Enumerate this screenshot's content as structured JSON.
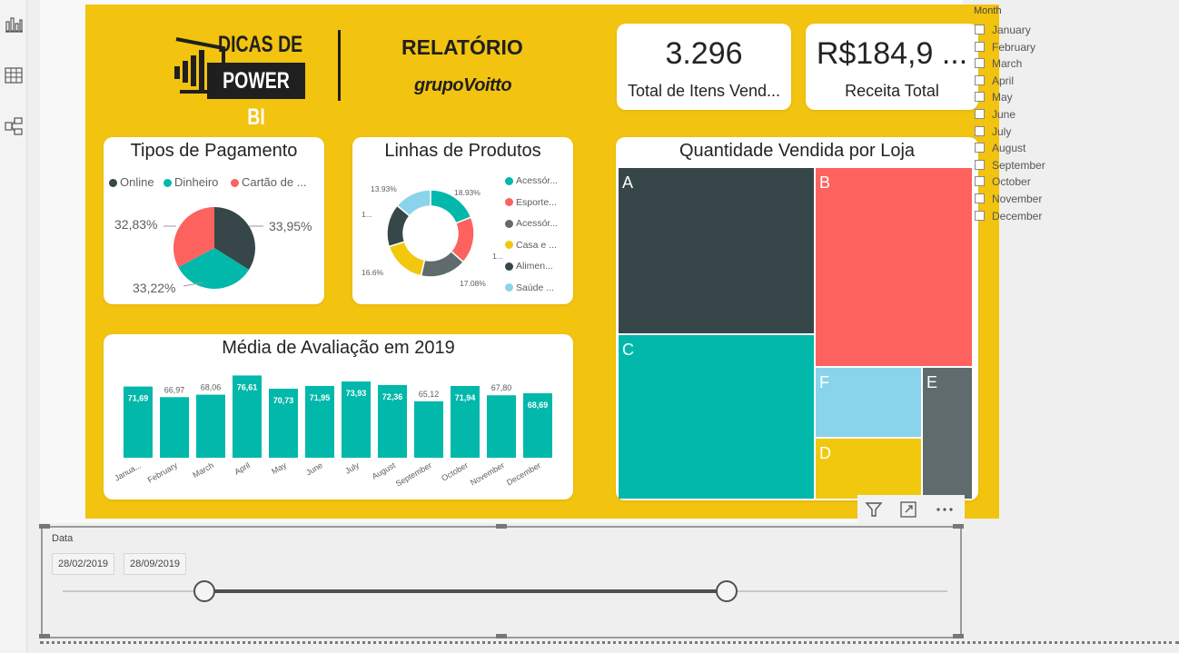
{
  "rail": {
    "icons": [
      "report-view-icon",
      "data-view-icon",
      "model-view-icon"
    ]
  },
  "header": {
    "logo_line1": "DICAS DE",
    "logo_line2": "POWER BI",
    "report_title": "RELATÓRIO",
    "brand": "grupoVoitto"
  },
  "kpis": [
    {
      "value": "3.296",
      "label": "Total de Itens Vend..."
    },
    {
      "value": "R$184,9 ...",
      "label": "Receita Total"
    }
  ],
  "colors": {
    "background": "#f2c30f",
    "dark": "#374649",
    "teal": "#01b8aa",
    "red": "#fd625e",
    "gray": "#5f6b6d",
    "yellow": "#f2c80f",
    "light_blue": "#8ad4eb"
  },
  "payments": {
    "title": "Tipos de Pagamento",
    "legend": [
      "Online",
      "Dinheiro",
      "Cartão de ..."
    ],
    "labels": [
      "33,95%",
      "33,22%",
      "32,83%"
    ]
  },
  "products": {
    "title": "Linhas de Produtos",
    "legend": [
      "Acessór...",
      "Esporte...",
      "Acessór...",
      "Casa e ...",
      "Alimen...",
      "Saúde ..."
    ],
    "labels": [
      "18.93%",
      "1...",
      "17.08%",
      "16.6%",
      "1...",
      "13.93%"
    ]
  },
  "ratings": {
    "title": "Média de Avaliação em 2019"
  },
  "treemap": {
    "title": "Quantidade Vendida por Loja",
    "labels": [
      "A",
      "B",
      "C",
      "F",
      "E",
      "D"
    ]
  },
  "chart_data": [
    {
      "type": "pie",
      "title": "Tipos de Pagamento",
      "categories": [
        "Online",
        "Dinheiro",
        "Cartão de ..."
      ],
      "values": [
        33.95,
        33.22,
        32.83
      ]
    },
    {
      "type": "pie",
      "title": "Linhas de Produtos",
      "categories": [
        "Acessór...",
        "Esporte...",
        "Acessór...",
        "Casa e ...",
        "Alimen...",
        "Saúde ..."
      ],
      "values": [
        18.93,
        17.5,
        17.08,
        16.6,
        15.96,
        13.93
      ]
    },
    {
      "type": "bar",
      "title": "Média de Avaliação em 2019",
      "categories": [
        "Janua...",
        "February",
        "March",
        "April",
        "May",
        "June",
        "July",
        "August",
        "September",
        "October",
        "November",
        "December"
      ],
      "values": [
        71.69,
        66.97,
        68.06,
        76.61,
        70.73,
        71.95,
        73.93,
        72.36,
        65.12,
        71.94,
        67.8,
        68.69
      ],
      "data_labels": [
        "71,69",
        "66,97",
        "68,06",
        "76,61",
        "70,73",
        "71,95",
        "73,93",
        "72,36",
        "65,12",
        "71,94",
        "67,80",
        "68,69"
      ],
      "grid": false
    },
    {
      "type": "treemap",
      "title": "Quantidade Vendida por Loja",
      "categories": [
        "A",
        "B",
        "C",
        "F",
        "E",
        "D"
      ]
    }
  ],
  "slicer": {
    "title": "Data",
    "start": "28/02/2019",
    "end": "28/09/2019",
    "range_start_fraction": 0.16,
    "range_end_fraction": 0.75
  },
  "month_slicer": {
    "title": "Month",
    "items": [
      "January",
      "February",
      "March",
      "April",
      "May",
      "June",
      "July",
      "August",
      "September",
      "October",
      "November",
      "December"
    ]
  }
}
